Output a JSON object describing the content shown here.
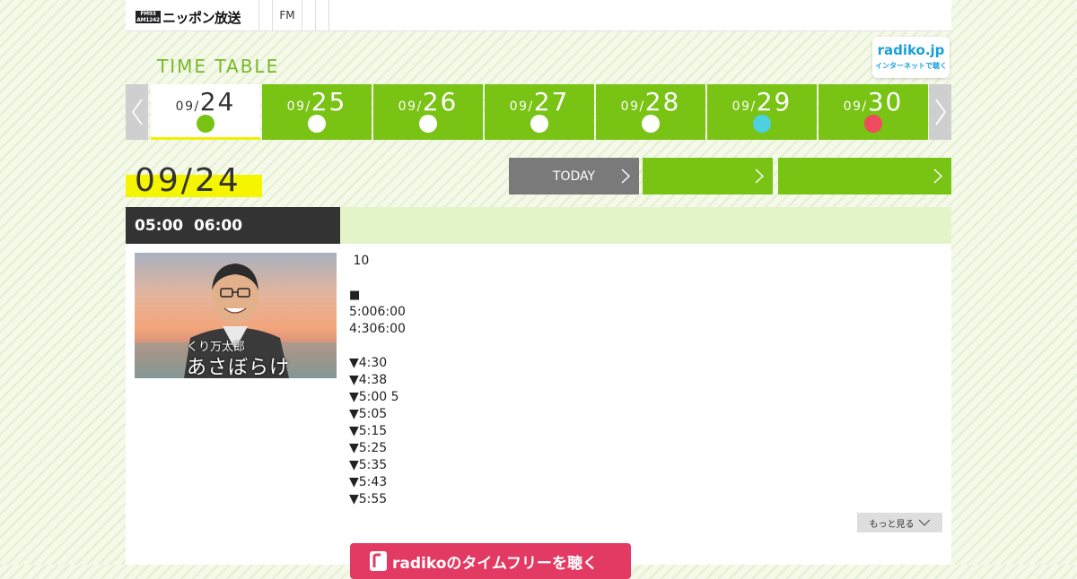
{
  "header": {
    "logo_badge_lines": [
      "FM93",
      "AM1242"
    ],
    "logo_name": "ニッポン放送",
    "nav_items": [
      "",
      "FM",
      "",
      ""
    ]
  },
  "timetable": {
    "title": "TIME TABLE",
    "radiko_logo": "radiko.jp",
    "radiko_sub": "インターネットで聴く"
  },
  "date_tabs": [
    {
      "month": "09/",
      "day": "24",
      "dot_color": "#78c314",
      "active": true
    },
    {
      "month": "09/",
      "day": "25",
      "dot_color": "#ffffff",
      "active": false
    },
    {
      "month": "09/",
      "day": "26",
      "dot_color": "#ffffff",
      "active": false
    },
    {
      "month": "09/",
      "day": "27",
      "dot_color": "#ffffff",
      "active": false
    },
    {
      "month": "09/",
      "day": "28",
      "dot_color": "#ffffff",
      "active": false
    },
    {
      "month": "09/",
      "day": "29",
      "dot_color": "#4dd0e1",
      "active": false
    },
    {
      "month": "09/",
      "day": "30",
      "dot_color": "#ef4b5f",
      "active": false
    }
  ],
  "date_heading": "09/24",
  "nav_buttons": {
    "today": "TODAY",
    "prev": "",
    "next": ""
  },
  "program": {
    "time": "05:00  06:00",
    "title": "",
    "thumbnail": {
      "name": "くり万太郎",
      "title": "あさぼらけ"
    },
    "description": [
      " 10",
      "",
      "■",
      "5:006:00",
      "4:306:00",
      "",
      "▼4:30",
      "▼4:38",
      "▼5:00 5",
      "▼5:05",
      "▼5:15",
      "▼5:25",
      "▼5:35",
      "▼5:43",
      "▼5:55"
    ],
    "more_label": "もっと見る",
    "radiko_button": "radikoのタイムフリーを聴く"
  },
  "colors": {
    "accent_green": "#78c314",
    "title_green": "#78b82a",
    "highlight_yellow": "#f5f500",
    "radiko_pink": "#e23a62",
    "radiko_blue": "#1aa0d6"
  }
}
